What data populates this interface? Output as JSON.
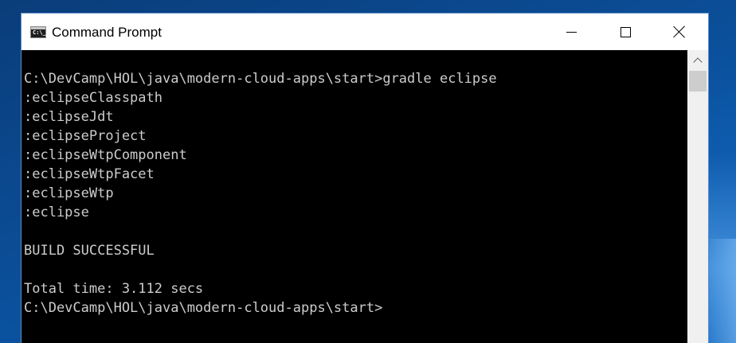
{
  "window": {
    "title": "Command Prompt",
    "app_icon_text": "C:\\_"
  },
  "icons": {
    "app": "command-prompt-icon",
    "minimize": "minimize-icon",
    "maximize": "maximize-icon",
    "close": "close-icon",
    "scroll_up": "chevron-up-icon"
  },
  "console": {
    "lines": [
      "",
      "C:\\DevCamp\\HOL\\java\\modern-cloud-apps\\start>gradle eclipse",
      ":eclipseClasspath",
      ":eclipseJdt",
      ":eclipseProject",
      ":eclipseWtpComponent",
      ":eclipseWtpFacet",
      ":eclipseWtp",
      ":eclipse",
      "",
      "BUILD SUCCESSFUL",
      "",
      "Total time: 3.112 secs",
      "C:\\DevCamp\\HOL\\java\\modern-cloud-apps\\start>"
    ],
    "text_color": "#cccccc",
    "background_color": "#000000"
  },
  "colors": {
    "desktop_background": "#0b4a91",
    "window_border": "#5b8ec9",
    "titlebar": "#ffffff",
    "scrollbar_track": "#f0f0f0",
    "scrollbar_thumb": "#cdcdcd"
  }
}
